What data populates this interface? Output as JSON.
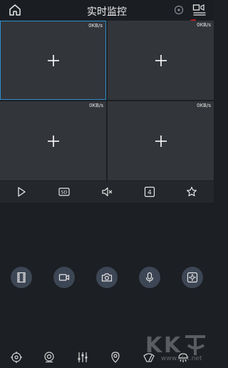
{
  "header": {
    "title": "实时监控"
  },
  "tiles": [
    {
      "rate": "0KB/s",
      "active": true
    },
    {
      "rate": "0KB/s",
      "active": false
    },
    {
      "rate": "0KB/s",
      "active": false
    },
    {
      "rate": "0KB/s",
      "active": false
    }
  ],
  "controls": {
    "quality_label": "SD",
    "split_count": "4"
  },
  "watermark": {
    "text": "www.kkx.net"
  },
  "colors": {
    "accent": "#2f8fd0",
    "arrow": "#e02020",
    "tile": "#32353a",
    "action_circle": "#3d4654"
  }
}
